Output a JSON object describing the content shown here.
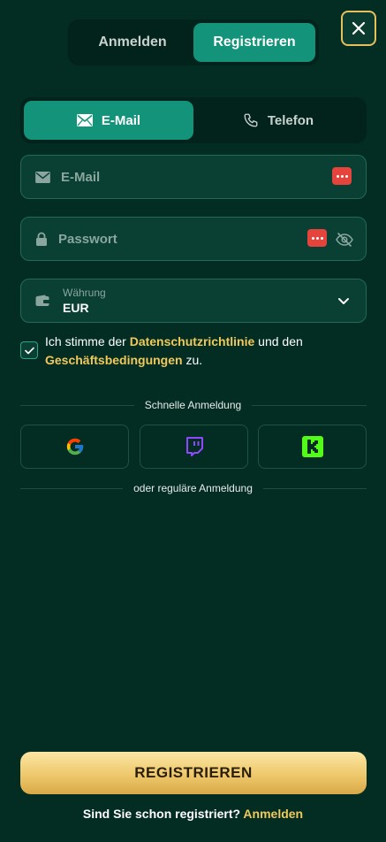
{
  "auth_tabs": {
    "login": "Anmelden",
    "register": "Registrieren"
  },
  "method_tabs": {
    "email": "E-Mail",
    "phone": "Telefon"
  },
  "fields": {
    "email_placeholder": "E-Mail",
    "password_placeholder": "Passwort",
    "currency_label": "Währung",
    "currency_value": "EUR"
  },
  "terms": {
    "prefix": "Ich stimme der ",
    "privacy_link": "Datenschutzrichtlinie",
    "middle": " und den ",
    "terms_link": "Geschäftsbedingungen",
    "suffix": " zu.",
    "checked": true
  },
  "quick_login": {
    "label": "Schnelle Anmeldung"
  },
  "social_icons": [
    "google-icon",
    "twitch-icon",
    "kick-icon"
  ],
  "regular_login": {
    "label": "oder reguläre Anmeldung"
  },
  "submit": {
    "label": "REGISTRIEREN"
  },
  "footer": {
    "question": "Sind Sie schon registriert? ",
    "link": "Anmelden"
  },
  "colors": {
    "background": "#032d23",
    "accent": "#13937a",
    "gold": "#f1c95b",
    "password_manager": "#e5443c"
  }
}
